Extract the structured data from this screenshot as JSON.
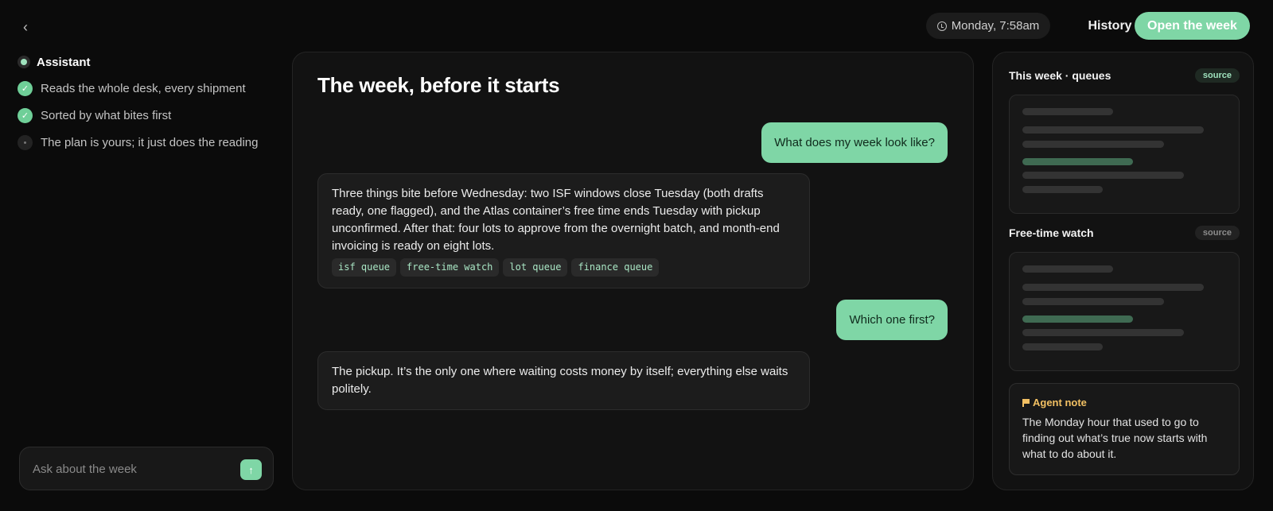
{
  "topbar": {
    "time": "Monday, 7:58am",
    "history_label": "History",
    "open_week_label": "Open the week"
  },
  "sidebar": {
    "assistant_label": "Assistant",
    "steps": [
      {
        "label": "Reads the whole desk, every shipment",
        "status": "done"
      },
      {
        "label": "Sorted by what bites first",
        "status": "done"
      },
      {
        "label": "The plan is yours; it just does the reading",
        "status": "pending"
      }
    ],
    "ask_placeholder": "Ask about the week"
  },
  "chat": {
    "title": "The week, before it starts",
    "messages": [
      {
        "role": "user",
        "text": "What does my week look like?"
      },
      {
        "role": "assistant",
        "text": "Three things bite before Wednesday: two ISF windows close Tuesday (both drafts ready, one flagged), and the Atlas container’s free time ends Tuesday with pickup unconfirmed. After that: four lots to approve from the overnight batch, and month-end invoicing is ready on eight lots.",
        "tags": [
          "isf queue",
          "free-time watch",
          "lot queue",
          "finance queue"
        ]
      },
      {
        "role": "user",
        "text": "Which one first?"
      },
      {
        "role": "assistant",
        "text": "The pickup. It’s the only one where waiting costs money by itself; everything else waits politely."
      }
    ]
  },
  "right_panel": {
    "cards": [
      {
        "title": "This week · queues",
        "badge": "source"
      },
      {
        "title": "Free-time watch",
        "badge": "source"
      }
    ],
    "note": {
      "title": "Agent note",
      "body": "The Monday hour that used to go to finding out what’s true now starts with what to do about it."
    }
  },
  "colors": {
    "accent": "#7fd6a6",
    "background": "#0b0b0b",
    "panel": "#121212",
    "note_title": "#f2c063"
  }
}
